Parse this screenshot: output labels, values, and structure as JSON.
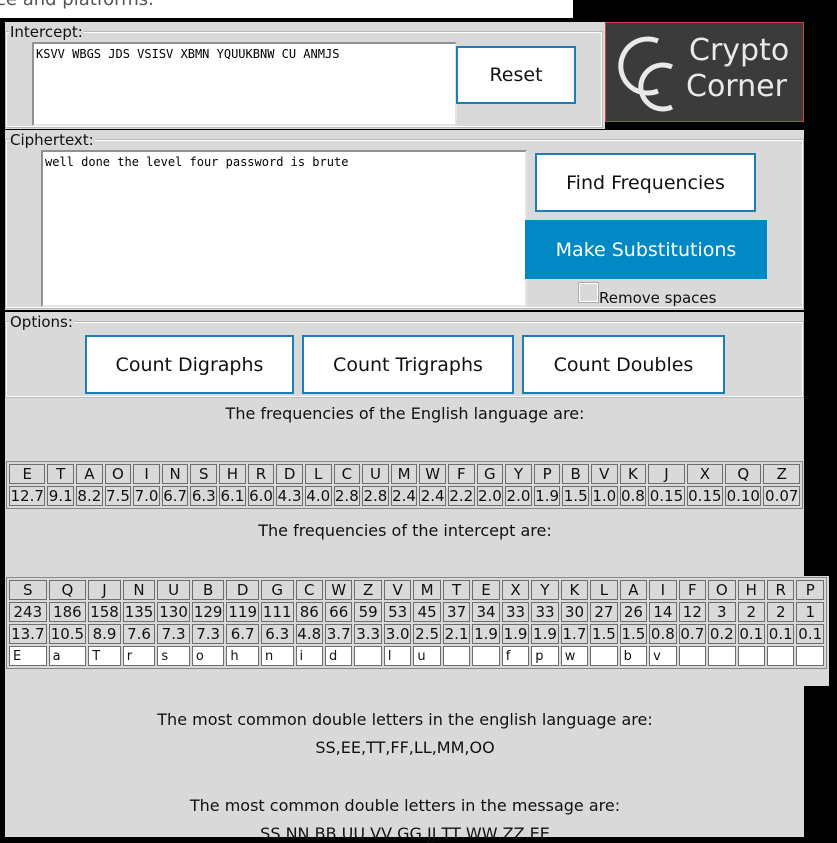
{
  "page": {
    "top_partial_text": "ce and platforms."
  },
  "intercept": {
    "legend": "Intercept:",
    "value": "KSVV WBGS JDS VSISV XBMN YQUUKBNW CU ANMJS",
    "reset_label": "Reset"
  },
  "logo": {
    "line1": "Crypto",
    "line2": "Corner",
    "icon": "cc-logo-icon"
  },
  "ciphertext": {
    "legend": "Ciphertext:",
    "value": "well done the level four password is brute",
    "find_label": "Find Frequencies",
    "make_label": "Make Substitutions",
    "remove_spaces_label": "Remove spaces",
    "remove_spaces_checked": false
  },
  "options": {
    "legend": "Options:",
    "digraphs_label": "Count Digraphs",
    "trigraphs_label": "Count Trigraphs",
    "doubles_label": "Count Doubles"
  },
  "english": {
    "heading": "The frequencies of the English language are:",
    "letters": [
      "E",
      "T",
      "A",
      "O",
      "I",
      "N",
      "S",
      "H",
      "R",
      "D",
      "L",
      "C",
      "U",
      "M",
      "W",
      "F",
      "G",
      "Y",
      "P",
      "B",
      "V",
      "K",
      "J",
      "X",
      "Q",
      "Z"
    ],
    "values": [
      "12.7",
      "9.1",
      "8.2",
      "7.5",
      "7.0",
      "6.7",
      "6.3",
      "6.1",
      "6.0",
      "4.3",
      "4.0",
      "2.8",
      "2.8",
      "2.4",
      "2.4",
      "2.2",
      "2.0",
      "2.0",
      "1.9",
      "1.5",
      "1.0",
      "0.8",
      "0.15",
      "0.15",
      "0.10",
      "0.07"
    ]
  },
  "intercept_freq": {
    "heading": "The frequencies of the intercept are:",
    "letters": [
      "S",
      "Q",
      "J",
      "N",
      "U",
      "B",
      "D",
      "G",
      "C",
      "W",
      "Z",
      "V",
      "M",
      "T",
      "E",
      "X",
      "Y",
      "K",
      "L",
      "A",
      "I",
      "F",
      "O",
      "H",
      "R",
      "P"
    ],
    "counts": [
      "243",
      "186",
      "158",
      "135",
      "130",
      "129",
      "119",
      "111",
      "86",
      "66",
      "59",
      "53",
      "45",
      "37",
      "34",
      "33",
      "33",
      "30",
      "27",
      "26",
      "14",
      "12",
      "3",
      "2",
      "2",
      "1"
    ],
    "percents": [
      "13.7",
      "10.5",
      "8.9",
      "7.6",
      "7.3",
      "7.3",
      "6.7",
      "6.3",
      "4.8",
      "3.7",
      "3.3",
      "3.0",
      "2.5",
      "2.1",
      "1.9",
      "1.9",
      "1.9",
      "1.7",
      "1.5",
      "1.5",
      "0.8",
      "0.7",
      "0.2",
      "0.1",
      "0.1",
      "0.1"
    ],
    "substitutions": [
      "E",
      "a",
      "T",
      "r",
      "s",
      "o",
      "h",
      "n",
      "i",
      "d",
      "",
      "l",
      "u",
      "",
      "",
      "f",
      "p",
      "w",
      "",
      "b",
      "v",
      "",
      "",
      "",
      "",
      ""
    ]
  },
  "doubles": {
    "english_heading": "The most common double letters in the english language are:",
    "english_list": "SS,EE,TT,FF,LL,MM,OO",
    "message_heading": "The most common double letters in the message are:",
    "message_list": "SS,NN,BB,UU,VV,GG,JJ,TT,WW,ZZ,EE"
  }
}
